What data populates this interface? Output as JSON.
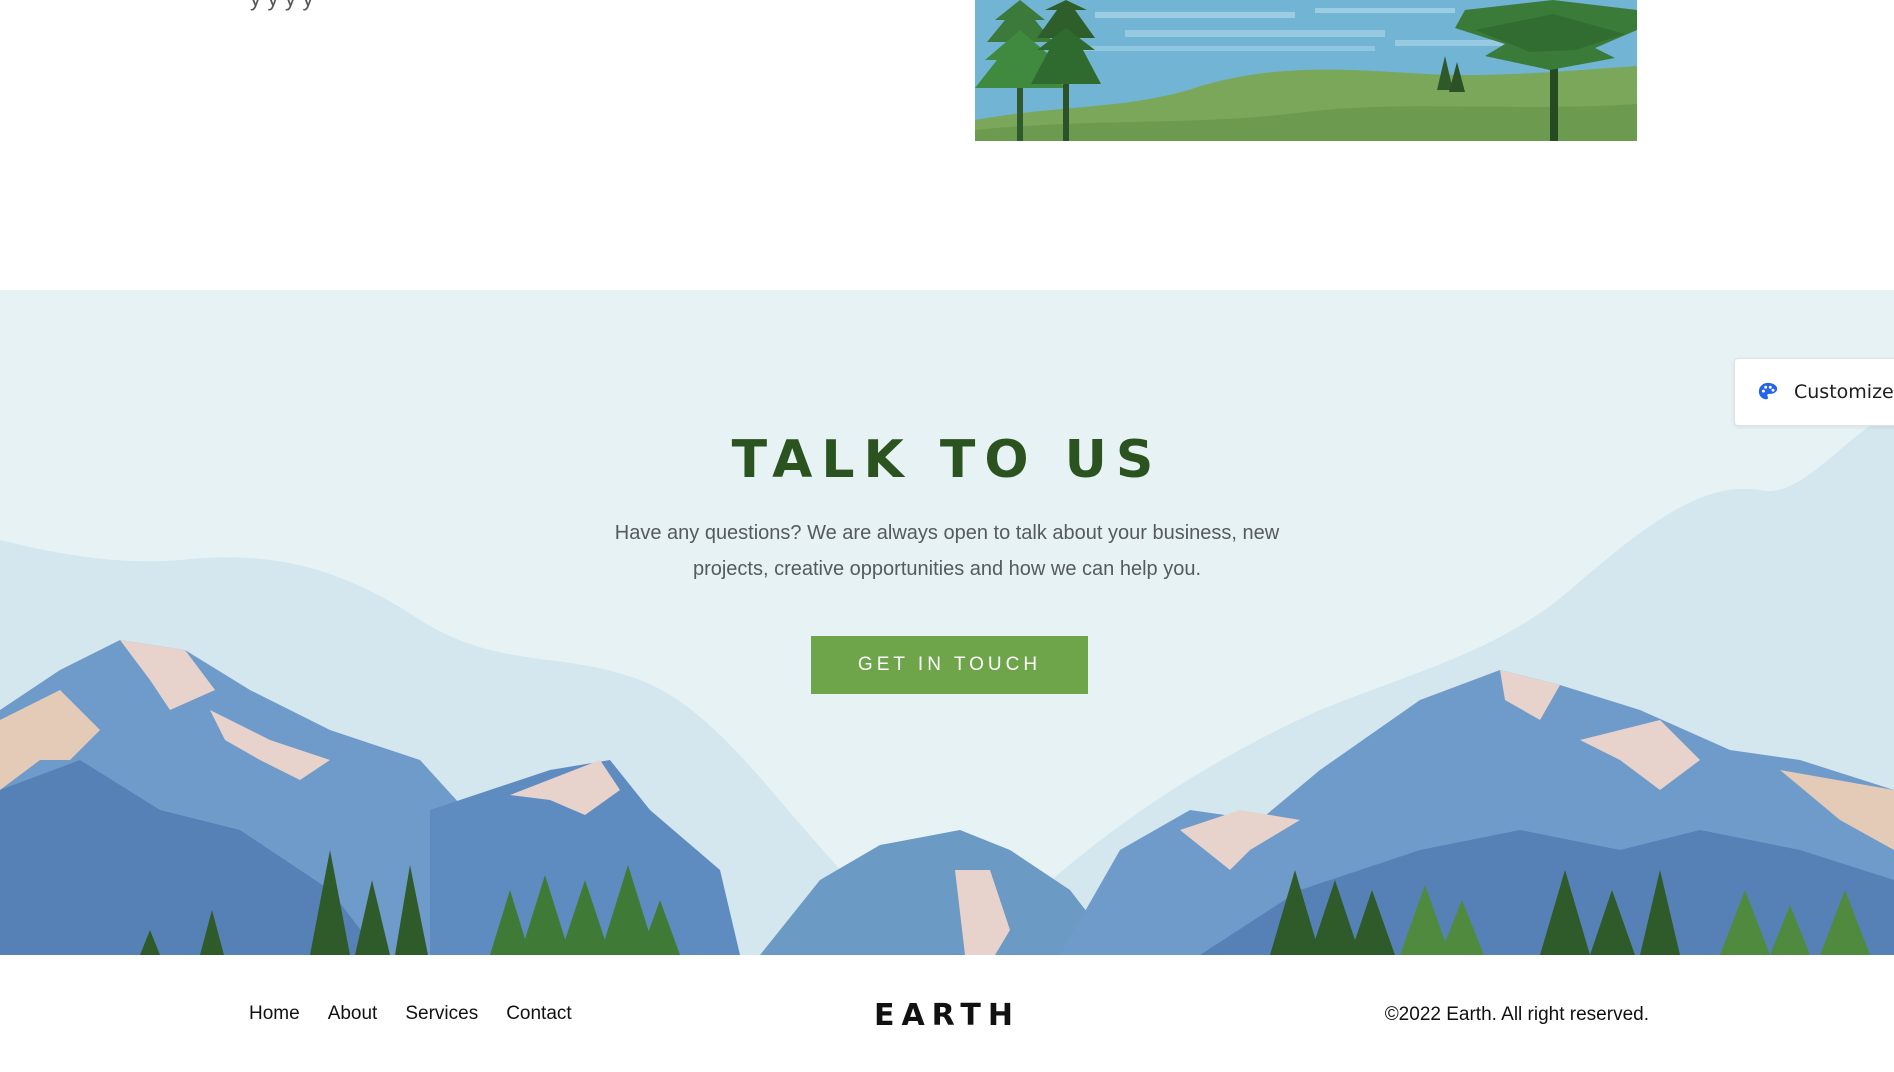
{
  "top_section": {
    "text_fragment": "y                                 y        y     y"
  },
  "talk_section": {
    "title": "TALK TO US",
    "description": "Have any questions? We are always open to talk about your business, new projects, creative opportunities and how we can help you.",
    "cta_label": "GET IN TOUCH"
  },
  "customize_tab": {
    "label": "Customize",
    "icon": "palette-icon"
  },
  "footer": {
    "nav": [
      "Home",
      "About",
      "Services",
      "Contact"
    ],
    "logo": "EARTH",
    "copyright": "©2022 Earth. All right reserved."
  },
  "colors": {
    "accent_green": "#6ea54a",
    "title_green": "#2b5320",
    "section_bg": "#e7f2f4",
    "customize_icon_blue": "#2563eb"
  }
}
